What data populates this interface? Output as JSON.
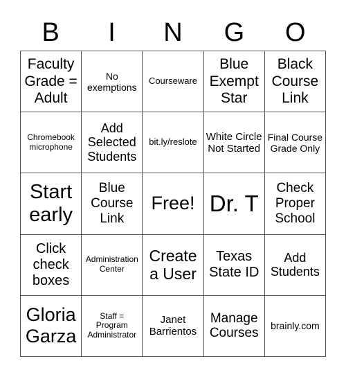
{
  "header": {
    "letters": [
      "B",
      "I",
      "N",
      "G",
      "O"
    ]
  },
  "cells": [
    [
      "Faculty Grade = Adult",
      "No exemptions",
      "Courseware",
      "Blue Exempt Star",
      "Black Course Link"
    ],
    [
      "Chromebook microphone",
      "Add Selected Students",
      "bit.ly/reslote",
      "White Circle Not Started",
      "Final Course Grade Only"
    ],
    [
      "Start early",
      "Blue Course Link",
      "Free!",
      "Dr. T",
      "Check Proper School"
    ],
    [
      "Click check boxes",
      "Administration Center",
      "Create a User",
      "Texas State ID",
      "Add Students"
    ],
    [
      "Gloria Garza",
      "Staff = Program Administrator",
      "Janet Barrientos",
      "Manage Courses",
      "brainly.com"
    ]
  ]
}
